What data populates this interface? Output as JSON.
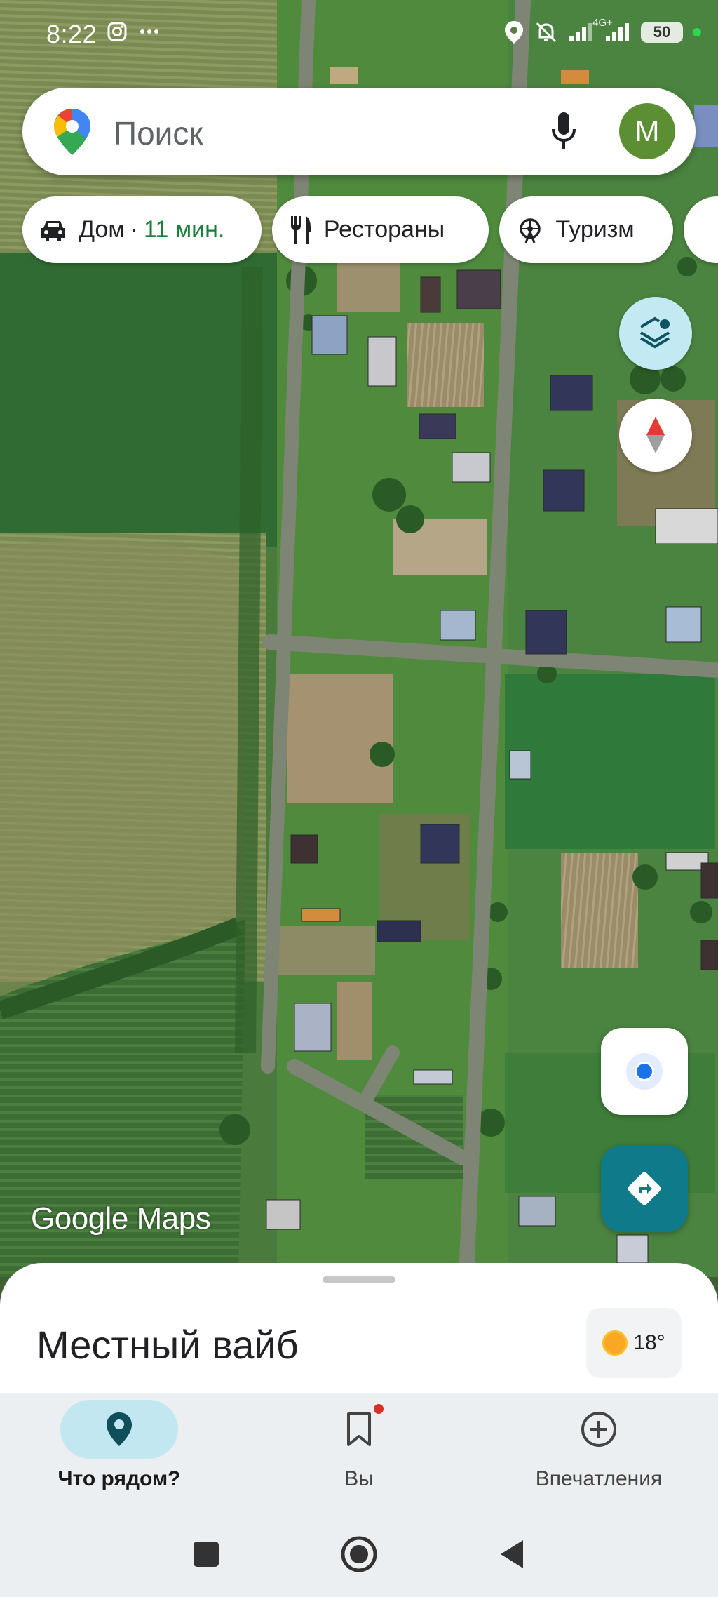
{
  "status_bar": {
    "time": "8:22",
    "network": "4G+",
    "battery": "50",
    "icons": [
      "instagram-icon",
      "more-dots-icon",
      "location-icon",
      "mute-icon",
      "signal-icon",
      "signal-icon",
      "battery-icon"
    ]
  },
  "search": {
    "placeholder": "Поиск",
    "avatar_letter": "M",
    "avatar_color": "#5c8f33"
  },
  "chips": {
    "home_label": "Дом",
    "home_separator": "·",
    "home_eta": "11 мин.",
    "restaurants_label": "Рестораны",
    "tourism_label": "Туризм"
  },
  "map": {
    "watermark": "Google Maps"
  },
  "sheet": {
    "title": "Местный вайб",
    "weather": "18°"
  },
  "nav": {
    "items": [
      {
        "label": "Что рядом?",
        "icon": "location-pin-icon",
        "active": true
      },
      {
        "label": "Вы",
        "icon": "bookmark-icon",
        "active": false
      },
      {
        "label": "Впечатления",
        "icon": "add-circle-icon",
        "active": false
      }
    ]
  },
  "colors": {
    "accent_teal": "#0f7a8a",
    "active_nav": "#c2e7f0",
    "eta_green": "#188038"
  }
}
